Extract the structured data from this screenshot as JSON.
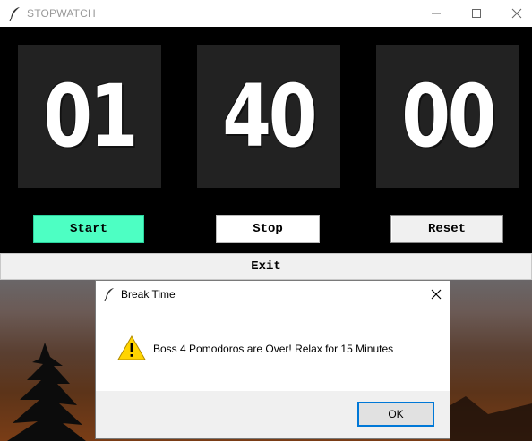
{
  "window": {
    "title": "STOPWATCH",
    "icon": "feather-icon",
    "controls": {
      "minimize": "—",
      "maximize": "☐",
      "close": "✕"
    }
  },
  "timer": {
    "hours": "01",
    "minutes": "40",
    "seconds": "00"
  },
  "buttons": {
    "start": "Start",
    "stop": "Stop",
    "reset": "Reset",
    "exit": "Exit"
  },
  "colors": {
    "start_bg": "#4dffc3",
    "panel_bg": "#222222",
    "app_bg": "#000000"
  },
  "dialog": {
    "title": "Break Time",
    "icon": "warning-icon",
    "message": "Boss 4 Pomodoros are Over! Relax for 15 Minutes",
    "ok_label": "OK",
    "close": "✕"
  }
}
